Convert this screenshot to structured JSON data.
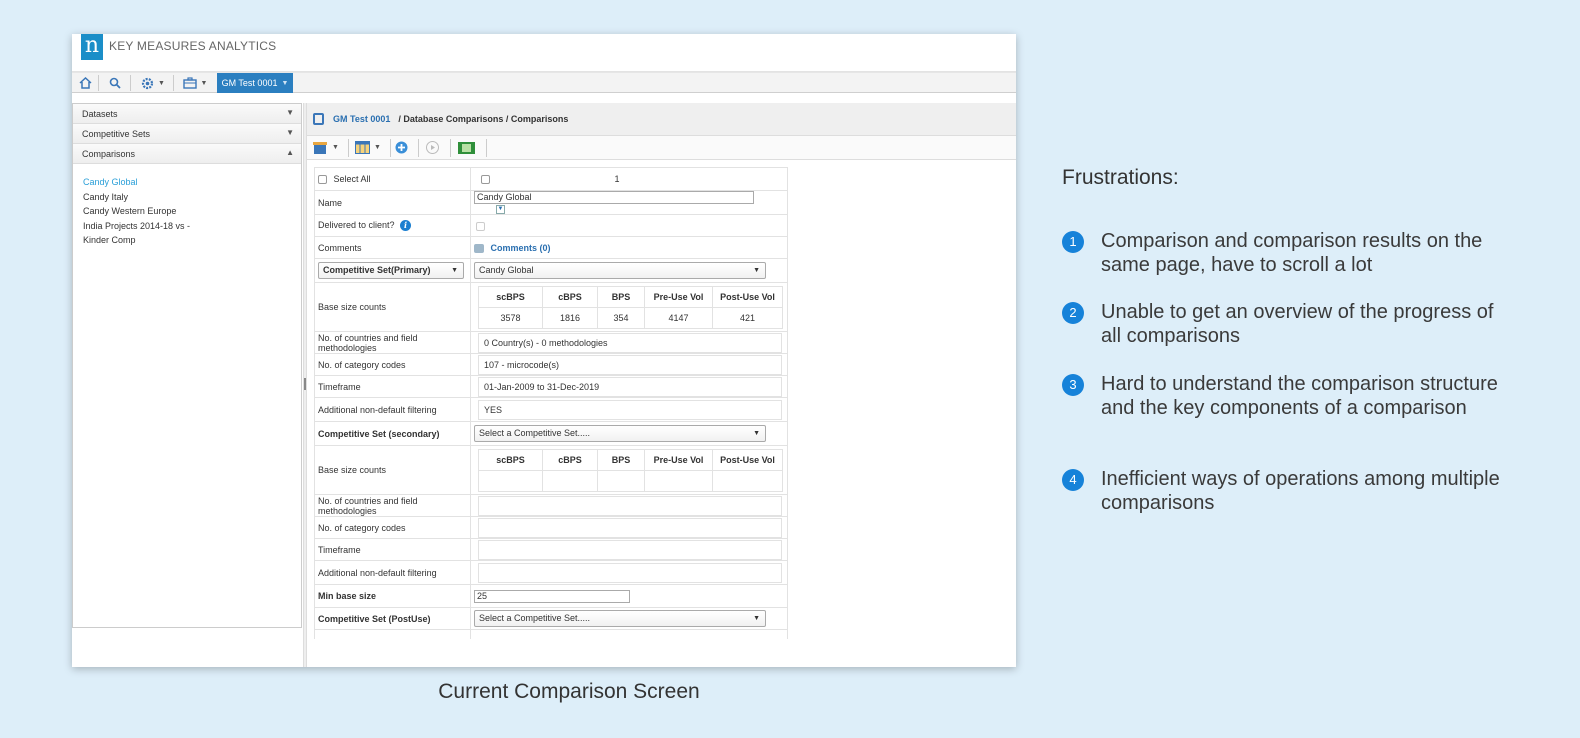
{
  "app": {
    "brand_letter": "n",
    "brand_name": "KEY MEASURES ANALYTICS",
    "active_tab": "GM Test 0001"
  },
  "sidebar": {
    "sections": [
      "Datasets",
      "Competitive Sets",
      "Comparisons"
    ],
    "items": [
      "Candy Global",
      "Candy Italy",
      "Candy Western Europe",
      "India Projects 2014-18 vs -",
      "Kinder Comp"
    ],
    "selected_item": "Candy Global"
  },
  "breadcrumb": {
    "project": "GM Test 0001",
    "path": "/ Database Comparisons / Comparisons"
  },
  "form": {
    "select_all_label": "Select All",
    "column_number": "1",
    "name_label": "Name",
    "name_value": "Candy Global",
    "delivered_label": "Delivered to client?",
    "comments_label": "Comments",
    "comments_link": "Comments (0)",
    "primary_set_label": "Competitive Set(Primary)",
    "primary_set_value": "Candy Global",
    "base_size_label": "Base size counts",
    "base_headers": [
      "scBPS",
      "cBPS",
      "BPS",
      "Pre-Use Vol",
      "Post-Use Vol"
    ],
    "base_values_primary": [
      "3578",
      "1816",
      "354",
      "4147",
      "421"
    ],
    "countries_label": "No. of countries and field methodologies",
    "countries_value": "0 Country(s) - 0 methodologies",
    "category_label": "No. of category codes",
    "category_value": "107 - microcode(s)",
    "timeframe_label": "Timeframe",
    "timeframe_value": "01-Jan-2009 to 31-Dec-2019",
    "filtering_label": "Additional non-default filtering",
    "filtering_value": "YES",
    "secondary_set_label": "Competitive Set (secondary)",
    "secondary_set_placeholder": "Select a Competitive Set.....",
    "min_base_label": "Min base size",
    "min_base_value": "25",
    "postuse_set_label": "Competitive Set (PostUse)",
    "postuse_set_placeholder": "Select a Competitive Set....."
  },
  "frustrations": {
    "title": "Frustrations:",
    "items": [
      {
        "num": "1",
        "text": "Comparison and comparison results on the same page, have to scroll a lot"
      },
      {
        "num": "2",
        "text": "Unable to get an overview of the progress of all comparisons"
      },
      {
        "num": "3",
        "text": "Hard to understand the comparison structure and the key components of a comparison"
      },
      {
        "num": "4",
        "text": "Inefficient ways of operations among multiple comparisons"
      }
    ]
  },
  "caption": "Current Comparison Screen",
  "colors": {
    "background": "#ddeef9",
    "accent": "#1682d9",
    "active_tab": "#2b7fc0",
    "selected_link": "#2a9fd8"
  }
}
